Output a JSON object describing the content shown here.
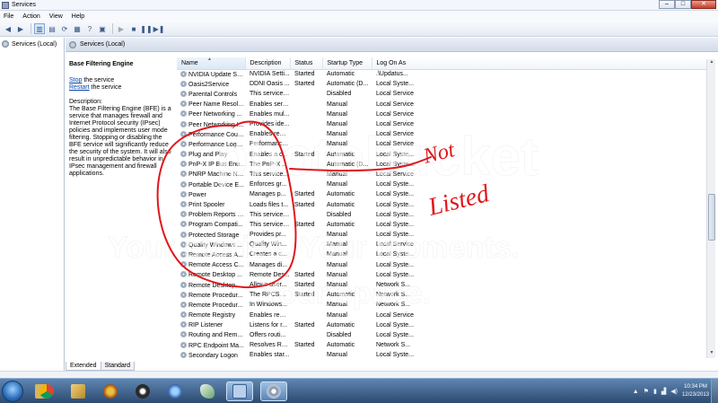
{
  "window": {
    "title": "Services"
  },
  "menu": [
    "File",
    "Action",
    "View",
    "Help"
  ],
  "tree": {
    "item": "Services (Local)"
  },
  "header": {
    "title": "Services (Local)"
  },
  "details": {
    "name": "Base Filtering Engine",
    "stop_link": "Stop",
    "stop_suffix": " the service",
    "restart_link": "Restart",
    "restart_suffix": " the service",
    "desc_label": "Description:",
    "description": "The Base Filtering Engine (BFE) is a service that manages firewall and Internet Protocol security (IPsec) policies and implements user mode filtering. Stopping or disabling the BFE service will significantly reduce the security of the system. It will also result in unpredictable behavior in IPsec management and firewall applications."
  },
  "columns": [
    "Name",
    "Description",
    "Status",
    "Startup Type",
    "Log On As"
  ],
  "services": [
    [
      "NVIDIA Update Se...",
      "NVIDIA Setti...",
      "Started",
      "Automatic",
      ".\\Updatus..."
    ],
    [
      "Oasis2Service",
      "DDNI Oasis ...",
      "Started",
      "Automatic (D...",
      "Local Syste..."
    ],
    [
      "Parental Controls",
      "This service ...",
      "",
      "Disabled",
      "Local Service"
    ],
    [
      "Peer Name Resolu...",
      "Enables serv...",
      "",
      "Manual",
      "Local Service"
    ],
    [
      "Peer Networking ...",
      "Enables mul...",
      "",
      "Manual",
      "Local Service"
    ],
    [
      "Peer Networking I...",
      "Provides ide...",
      "",
      "Manual",
      "Local Service"
    ],
    [
      "Performance Coun...",
      "Enables rem...",
      "",
      "Manual",
      "Local Service"
    ],
    [
      "Performance Logs...",
      "Performance...",
      "",
      "Manual",
      "Local Service"
    ],
    [
      "Plug and Play",
      "Enables a c...",
      "Started",
      "Automatic",
      "Local Syste..."
    ],
    [
      "PnP-X IP Bus Enu...",
      "The PnP-X ...",
      "",
      "Automatic (D...",
      "Local Syste..."
    ],
    [
      "PNRP Machine Na...",
      "This service ...",
      "",
      "Manual",
      "Local Service"
    ],
    [
      "Portable Device E...",
      "Enforces gr...",
      "",
      "Manual",
      "Local Syste..."
    ],
    [
      "Power",
      "Manages p...",
      "Started",
      "Automatic",
      "Local Syste..."
    ],
    [
      "Print Spooler",
      "Loads files t...",
      "Started",
      "Automatic",
      "Local Syste..."
    ],
    [
      "Problem Reports a...",
      "This service ...",
      "",
      "Disabled",
      "Local Syste..."
    ],
    [
      "Program Compati...",
      "This service ...",
      "Started",
      "Automatic",
      "Local Syste..."
    ],
    [
      "Protected Storage",
      "Provides pr...",
      "",
      "Manual",
      "Local Syste..."
    ],
    [
      "Quality Windows ...",
      "Quality Win...",
      "",
      "Manual",
      "Local Service"
    ],
    [
      "Remote Access A...",
      "Creates a co...",
      "",
      "Manual",
      "Local Syste..."
    ],
    [
      "Remote Access C...",
      "Manages di...",
      "",
      "Manual",
      "Local Syste..."
    ],
    [
      "Remote Desktop ...",
      "Remote Des...",
      "Started",
      "Manual",
      "Local Syste..."
    ],
    [
      "Remote Desktop S...",
      "Allows user...",
      "Started",
      "Manual",
      "Network S..."
    ],
    [
      "Remote Procedur...",
      "The RPCSS ...",
      "Started",
      "Automatic",
      "Network S..."
    ],
    [
      "Remote Procedur...",
      "In Windows...",
      "",
      "Manual",
      "Network S..."
    ],
    [
      "Remote Registry",
      "Enables rem...",
      "",
      "Manual",
      "Local Service"
    ],
    [
      "RIP Listener",
      "Listens for r...",
      "Started",
      "Automatic",
      "Local Syste..."
    ],
    [
      "Routing and Rem...",
      "Offers routi...",
      "",
      "Disabled",
      "Local Syste..."
    ],
    [
      "RPC Endpoint Ma...",
      "Resolves RP...",
      "Started",
      "Automatic",
      "Network S..."
    ],
    [
      "Secondary Logon",
      "Enables star...",
      "",
      "Manual",
      "Local Syste..."
    ]
  ],
  "tabs": [
    "Extended",
    "Standard"
  ],
  "annotation": {
    "line1": "Not",
    "line2": "Listed"
  },
  "watermark": {
    "brand": "photobucket",
    "tagline1": "Your stories. Your moments.",
    "tagline2": "Your space."
  },
  "clock": {
    "time": "10:34 PM",
    "date": "12/23/2013"
  },
  "colors": {
    "annotation": "#e0161b",
    "taskbar": "#2d4a70",
    "link": "#0645ad"
  }
}
